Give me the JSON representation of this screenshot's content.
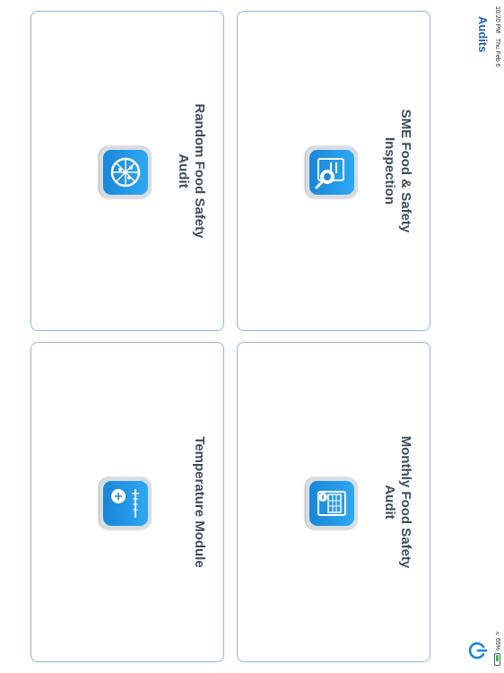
{
  "status_bar": {
    "time": "10:20 PM",
    "date": "Thu Feb 6",
    "battery": "65%"
  },
  "nav": {
    "title": "Audits"
  },
  "cards": [
    {
      "label": "SME Food & Safety\nInspection",
      "icon": "checklist-scope-icon"
    },
    {
      "label": "Monthly Food Safety\nAudit",
      "icon": "clipboard-calendar-icon"
    },
    {
      "label": "Random Food Safety\nAudit",
      "icon": "pizza-icon"
    },
    {
      "label": "Temperature Module",
      "icon": "thermometer-icon"
    }
  ],
  "colors": {
    "accent": "#1f5fb8",
    "card_border": "#8fb3e0",
    "icon_blue": "#1a86d8",
    "label_text": "#3d4b5c"
  }
}
